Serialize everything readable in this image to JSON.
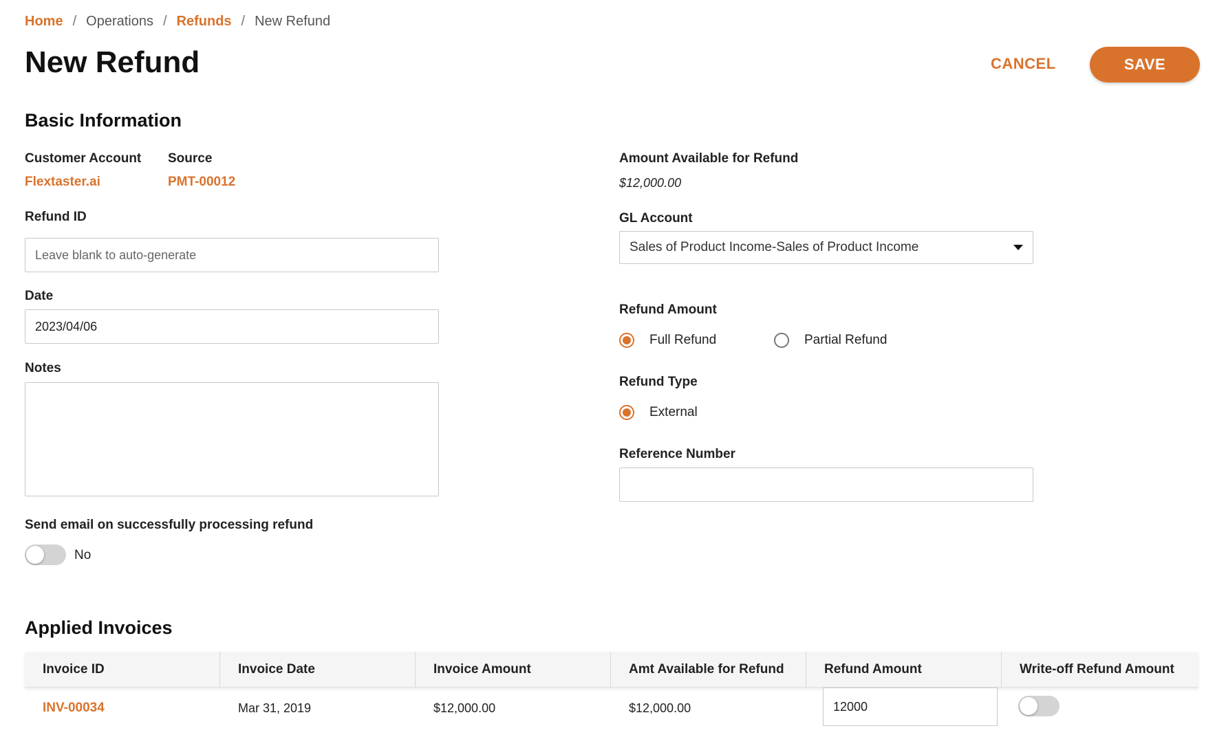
{
  "breadcrumb": {
    "home": "Home",
    "operations": "Operations",
    "refunds": "Refunds",
    "current": "New Refund",
    "separator": "/"
  },
  "page_title": "New Refund",
  "actions": {
    "cancel": "CANCEL",
    "save": "SAVE"
  },
  "colors": {
    "accent": "#d9732c",
    "toggle_off": "#d4d4d4"
  },
  "basic": {
    "title": "Basic Information",
    "customer_account_label": "Customer Account",
    "customer_account_value": "Flextaster.ai",
    "source_label": "Source",
    "source_value": "PMT-00012",
    "refund_id_label": "Refund ID",
    "refund_id_placeholder": "Leave blank to auto-generate",
    "date_label": "Date",
    "date_value": "2023/04/06",
    "notes_label": "Notes",
    "send_email_label": "Send email on successfully processing refund",
    "send_email_value": "No"
  },
  "right": {
    "available_label": "Amount Available for Refund",
    "available_value": "$12,000.00",
    "gl_label": "GL Account",
    "gl_value": "Sales of Product Income-Sales of Product Income",
    "refund_amount_label": "Refund Amount",
    "full_refund": "Full Refund",
    "partial_refund": "Partial Refund",
    "refund_type_label": "Refund Type",
    "external": "External",
    "reference_label": "Reference Number"
  },
  "invoices": {
    "title": "Applied Invoices",
    "columns": [
      "Invoice ID",
      "Invoice Date",
      "Invoice Amount",
      "Amt Available for Refund",
      "Refund Amount",
      "Write-off Refund Amount"
    ],
    "rows": [
      {
        "invoice_id": "INV-00034",
        "invoice_date": "Mar 31, 2019",
        "invoice_amount": "$12,000.00",
        "available": "$12,000.00",
        "refund_amount": "12000",
        "write_off": false
      }
    ]
  }
}
